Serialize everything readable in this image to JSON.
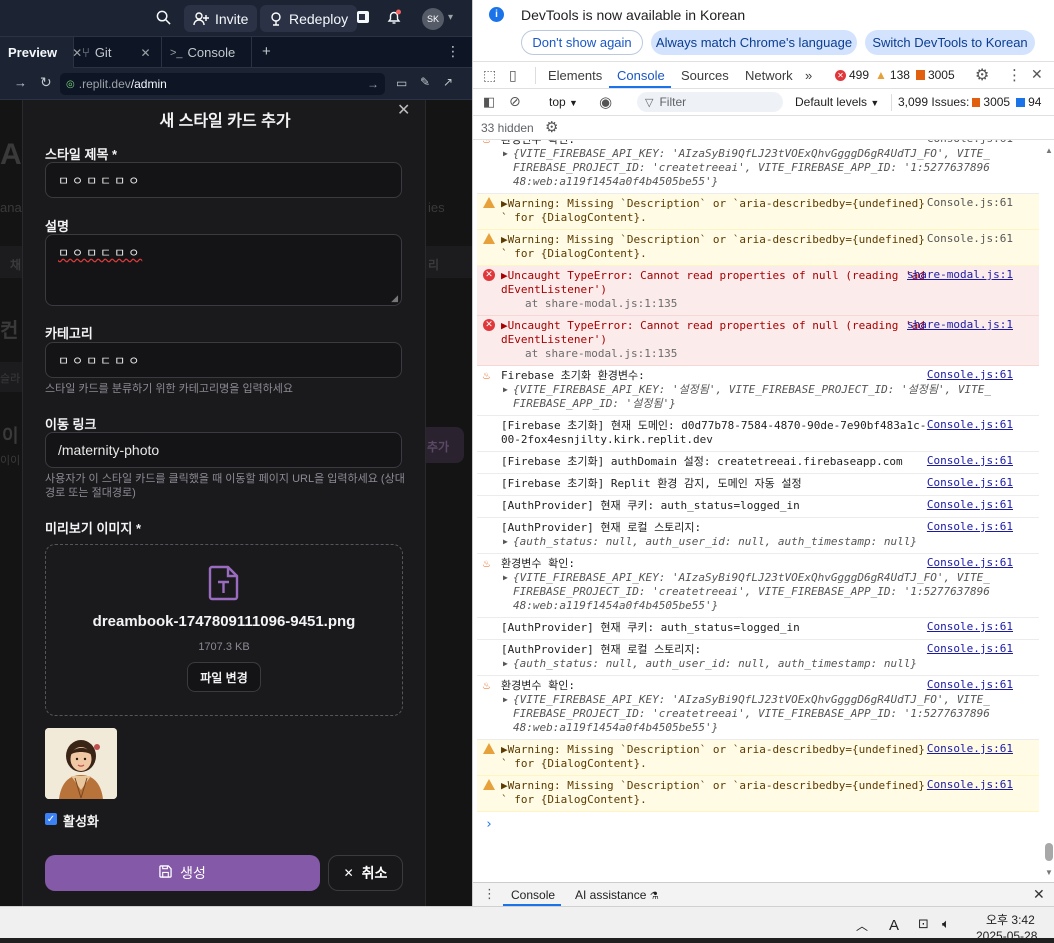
{
  "replit": {
    "invite_label": "Invite",
    "redeploy_label": "Redeploy",
    "avatar_initials": "SK",
    "tabs": [
      {
        "label": "Preview"
      },
      {
        "label": "Git"
      },
      {
        "label": "Console"
      }
    ],
    "url_domain": ".replit.dev",
    "url_path": "/admin"
  },
  "background": {
    "ghost_texts": [
      "Ad",
      "ana",
      "ies",
      "채",
      "리",
      "컨",
      "슬라",
      "추가",
      "이",
      "이이"
    ]
  },
  "modal": {
    "title": "새 스타일 카드 추가",
    "title_label": "스타일 제목 *",
    "title_value": "ㅁㅇㅁㄷㅁㅇ",
    "description_label": "설명",
    "description_value": "ㅁㅇㅁㄷㅁㅇ",
    "category_label": "카테고리",
    "category_value": "ㅁㅇㅁㄷㅁㅇ",
    "category_hint": "스타일 카드를 분류하기 위한 카테고리명을 입력하세요",
    "link_label": "이동 링크",
    "link_value": "/maternity-photo",
    "link_hint": "사용자가 이 스타일 카드를 클릭했을 때 이동할 페이지 URL을 입력하세요 (상대 경로 또는 절대경로)",
    "image_label": "미리보기 이미지 *",
    "file_name": "dreambook-1747809111096-9451.png",
    "file_size": "1707.3 KB",
    "change_file_label": "파일 변경",
    "active_label": "활성화",
    "active_checked": true,
    "submit_label": "생성",
    "cancel_label": "취소"
  },
  "devtools": {
    "notice_text": "DevTools is now available in Korean",
    "dont_show_label": "Don't show again",
    "match_language_label": "Always match Chrome's language",
    "switch_label": "Switch DevTools to Korean",
    "tabs": [
      "Elements",
      "Console",
      "Sources",
      "Network"
    ],
    "active_tab": "Console",
    "error_count": "499",
    "warning_count": "138",
    "issue_count": "3005",
    "context": "top",
    "filter_placeholder": "Filter",
    "levels_label": "Default levels",
    "issues_label": "3,099 Issues:",
    "issues_errors": "3005",
    "issues_info": "94",
    "hidden_label": "33 hidden",
    "messages": [
      {
        "kind": "log",
        "icon": "fire",
        "text": "환경변수 확인:",
        "source": "Console.js:61",
        "obj": "{VITE_FIREBASE_API_KEY: 'AIzaSyBi9QfLJ23tVOExQhvGgggD6gR4UdTJ_FO', VITE_FIREBASE_PROJECT_ID: 'createtreeai', VITE_FIREBASE_APP_ID: '1:527763789648:web:a119f1454a0f4b4505be55'}"
      },
      {
        "kind": "warn",
        "text": "▶Warning: Missing `Description` or `aria-describedby={undefined}` for {DialogContent}.",
        "source": "Console.js:61"
      },
      {
        "kind": "warn",
        "text": "▶Warning: Missing `Description` or `aria-describedby={undefined}` for {DialogContent}.",
        "source": "Console.js:61"
      },
      {
        "kind": "err",
        "text": "▶Uncaught TypeError: Cannot read properties of null (reading 'addEventListener')",
        "at": "at share-modal.js:1:135",
        "source": "share-modal.js:1"
      },
      {
        "kind": "err",
        "text": "▶Uncaught TypeError: Cannot read properties of null (reading 'addEventListener')",
        "at": "at share-modal.js:1:135",
        "source": "share-modal.js:1"
      },
      {
        "kind": "log",
        "icon": "fire",
        "text": "Firebase 초기화 환경변수:",
        "source": "Console.js:61",
        "obj": "{VITE_FIREBASE_API_KEY: '설정됨', VITE_FIREBASE_PROJECT_ID: '설정됨', VITE_FIREBASE_APP_ID: '설정됨'}"
      },
      {
        "kind": "log",
        "text": "[Firebase 초기화] 현재 도메인: d0d77b78-7584-4870-90de-7e90bf483a1c-00-2fox4esnjilty.kirk.replit.dev",
        "source": "Console.js:61"
      },
      {
        "kind": "log",
        "text": "[Firebase 초기화] authDomain 설정: createtreeai.firebaseapp.com",
        "source": "Console.js:61"
      },
      {
        "kind": "log",
        "text": "[Firebase 초기화] Replit 환경 감지, 도메인 자동 설정",
        "source": "Console.js:61"
      },
      {
        "kind": "log",
        "text": "[AuthProvider] 현재 쿠키: auth_status=logged_in",
        "source": "Console.js:61"
      },
      {
        "kind": "log",
        "text": "[AuthProvider] 현재 로컬 스토리지:",
        "source": "Console.js:61",
        "obj": "{auth_status: null, auth_user_id: null, auth_timestamp: null}"
      },
      {
        "kind": "log",
        "icon": "fire",
        "text": "환경변수 확인:",
        "source": "Console.js:61",
        "obj": "{VITE_FIREBASE_API_KEY: 'AIzaSyBi9QfLJ23tVOExQhvGgggD6gR4UdTJ_FO', VITE_FIREBASE_PROJECT_ID: 'createtreeai', VITE_FIREBASE_APP_ID: '1:527763789648:web:a119f1454a0f4b4505be55'}"
      },
      {
        "kind": "log",
        "text": "[AuthProvider] 현재 쿠키: auth_status=logged_in",
        "source": "Console.js:61"
      },
      {
        "kind": "log",
        "text": "[AuthProvider] 현재 로컬 스토리지:",
        "source": "Console.js:61",
        "obj": "{auth_status: null, auth_user_id: null, auth_timestamp: null}"
      },
      {
        "kind": "log",
        "icon": "fire",
        "text": "환경변수 확인:",
        "source": "Console.js:61",
        "obj": "{VITE_FIREBASE_API_KEY: 'AIzaSyBi9QfLJ23tVOExQhvGgggD6gR4UdTJ_FO', VITE_FIREBASE_PROJECT_ID: 'createtreeai', VITE_FIREBASE_APP_ID: '1:527763789648:web:a119f1454a0f4b4505be55'}"
      },
      {
        "kind": "warn",
        "text": "▶Warning: Missing `Description` or `aria-describedby={undefined}` for {DialogContent}.",
        "source": "Console.js:61"
      },
      {
        "kind": "warn",
        "text": "▶Warning: Missing `Description` or `aria-describedby={undefined}` for {DialogContent}.",
        "source": "Console.js:61"
      }
    ],
    "drawer_console_label": "Console",
    "drawer_ai_label": "AI assistance"
  },
  "taskbar": {
    "time": "오후 3:42",
    "date": "2025-05-28",
    "ime": "A"
  },
  "colors": {
    "accent_purple": "#8459a8",
    "devtools_blue": "#1a73e8",
    "error_red": "#e0373b",
    "warning_amber": "#e7a13a"
  }
}
